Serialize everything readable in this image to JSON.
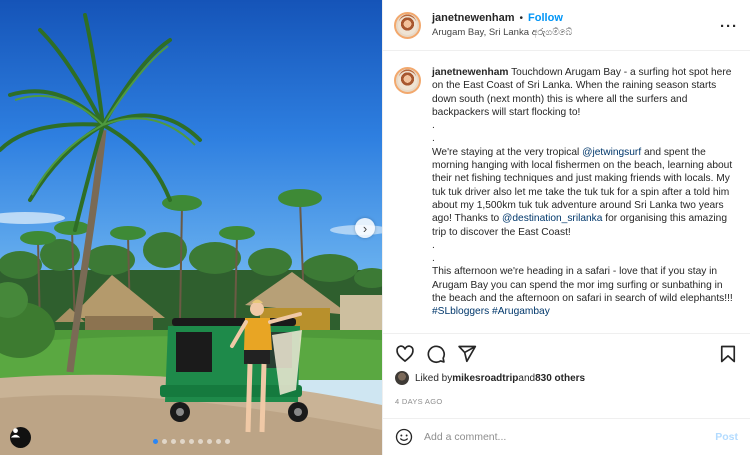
{
  "post": {
    "username": "janetnewenham",
    "separator": "•",
    "follow_label": "Follow",
    "location": "Arugam Bay, Sri Lanka අරුගම්බේ",
    "more_icon": "more-options-icon",
    "carousel": {
      "slide_count": 9,
      "active_slide": 1,
      "next_icon": "chevron-right-icon",
      "tag_icon": "tagged-user-icon"
    }
  },
  "caption": {
    "username": "janetnewenham",
    "line1": " Touchdown Arugam Bay - a surfing hot spot here on the East Coast of Sri Lanka. When the raining season starts down south (next month) this is where all the surfers and backpackers will start flocking to!",
    "dot1": ".",
    "dot2": ".",
    "p2_a": "We're staying at the very tropical ",
    "p2_mention": "@jetwingsurf",
    "p2_b": " and spent the morning hanging with local fishermen on the beach, learning about their net fishing techniques and just making friends with locals. My tuk tuk driver also let me take the tuk tuk for a spin after a told him about my 1,500km tuk tuk adventure around Sri Lanka two years ago! Thanks to ",
    "p2_mention2": "@destination_srilanka",
    "p2_c": " for organising this amazing trip to discover the East Coast!",
    "dot3": ".",
    "dot4": ".",
    "p3": "This afternoon we're heading in a safari - love that if you stay in Arugam Bay you can spend the mor img surfing or sunbathing in the beach and the afternoon on safari in search of wild elephants!!! ",
    "hashtag1": "#SLbloggers",
    "hashtag2": " #Arugambay"
  },
  "actions": {
    "icons": [
      "heart-icon",
      "comment-icon",
      "share-icon",
      "bookmark-icon"
    ]
  },
  "likes": {
    "prefix": "Liked by ",
    "user": "mikesroadtrip",
    "middle": " and ",
    "count": "830 others"
  },
  "timestamp": "4 DAYS AGO",
  "comment": {
    "placeholder": "Add a comment...",
    "post_label": "Post",
    "emoji_icon": "emoji-icon"
  },
  "colors": {
    "accent": "#0095f6",
    "post_disabled": "#b3dbff",
    "mention": "#00376b",
    "active_dot": "#2a86f5"
  }
}
